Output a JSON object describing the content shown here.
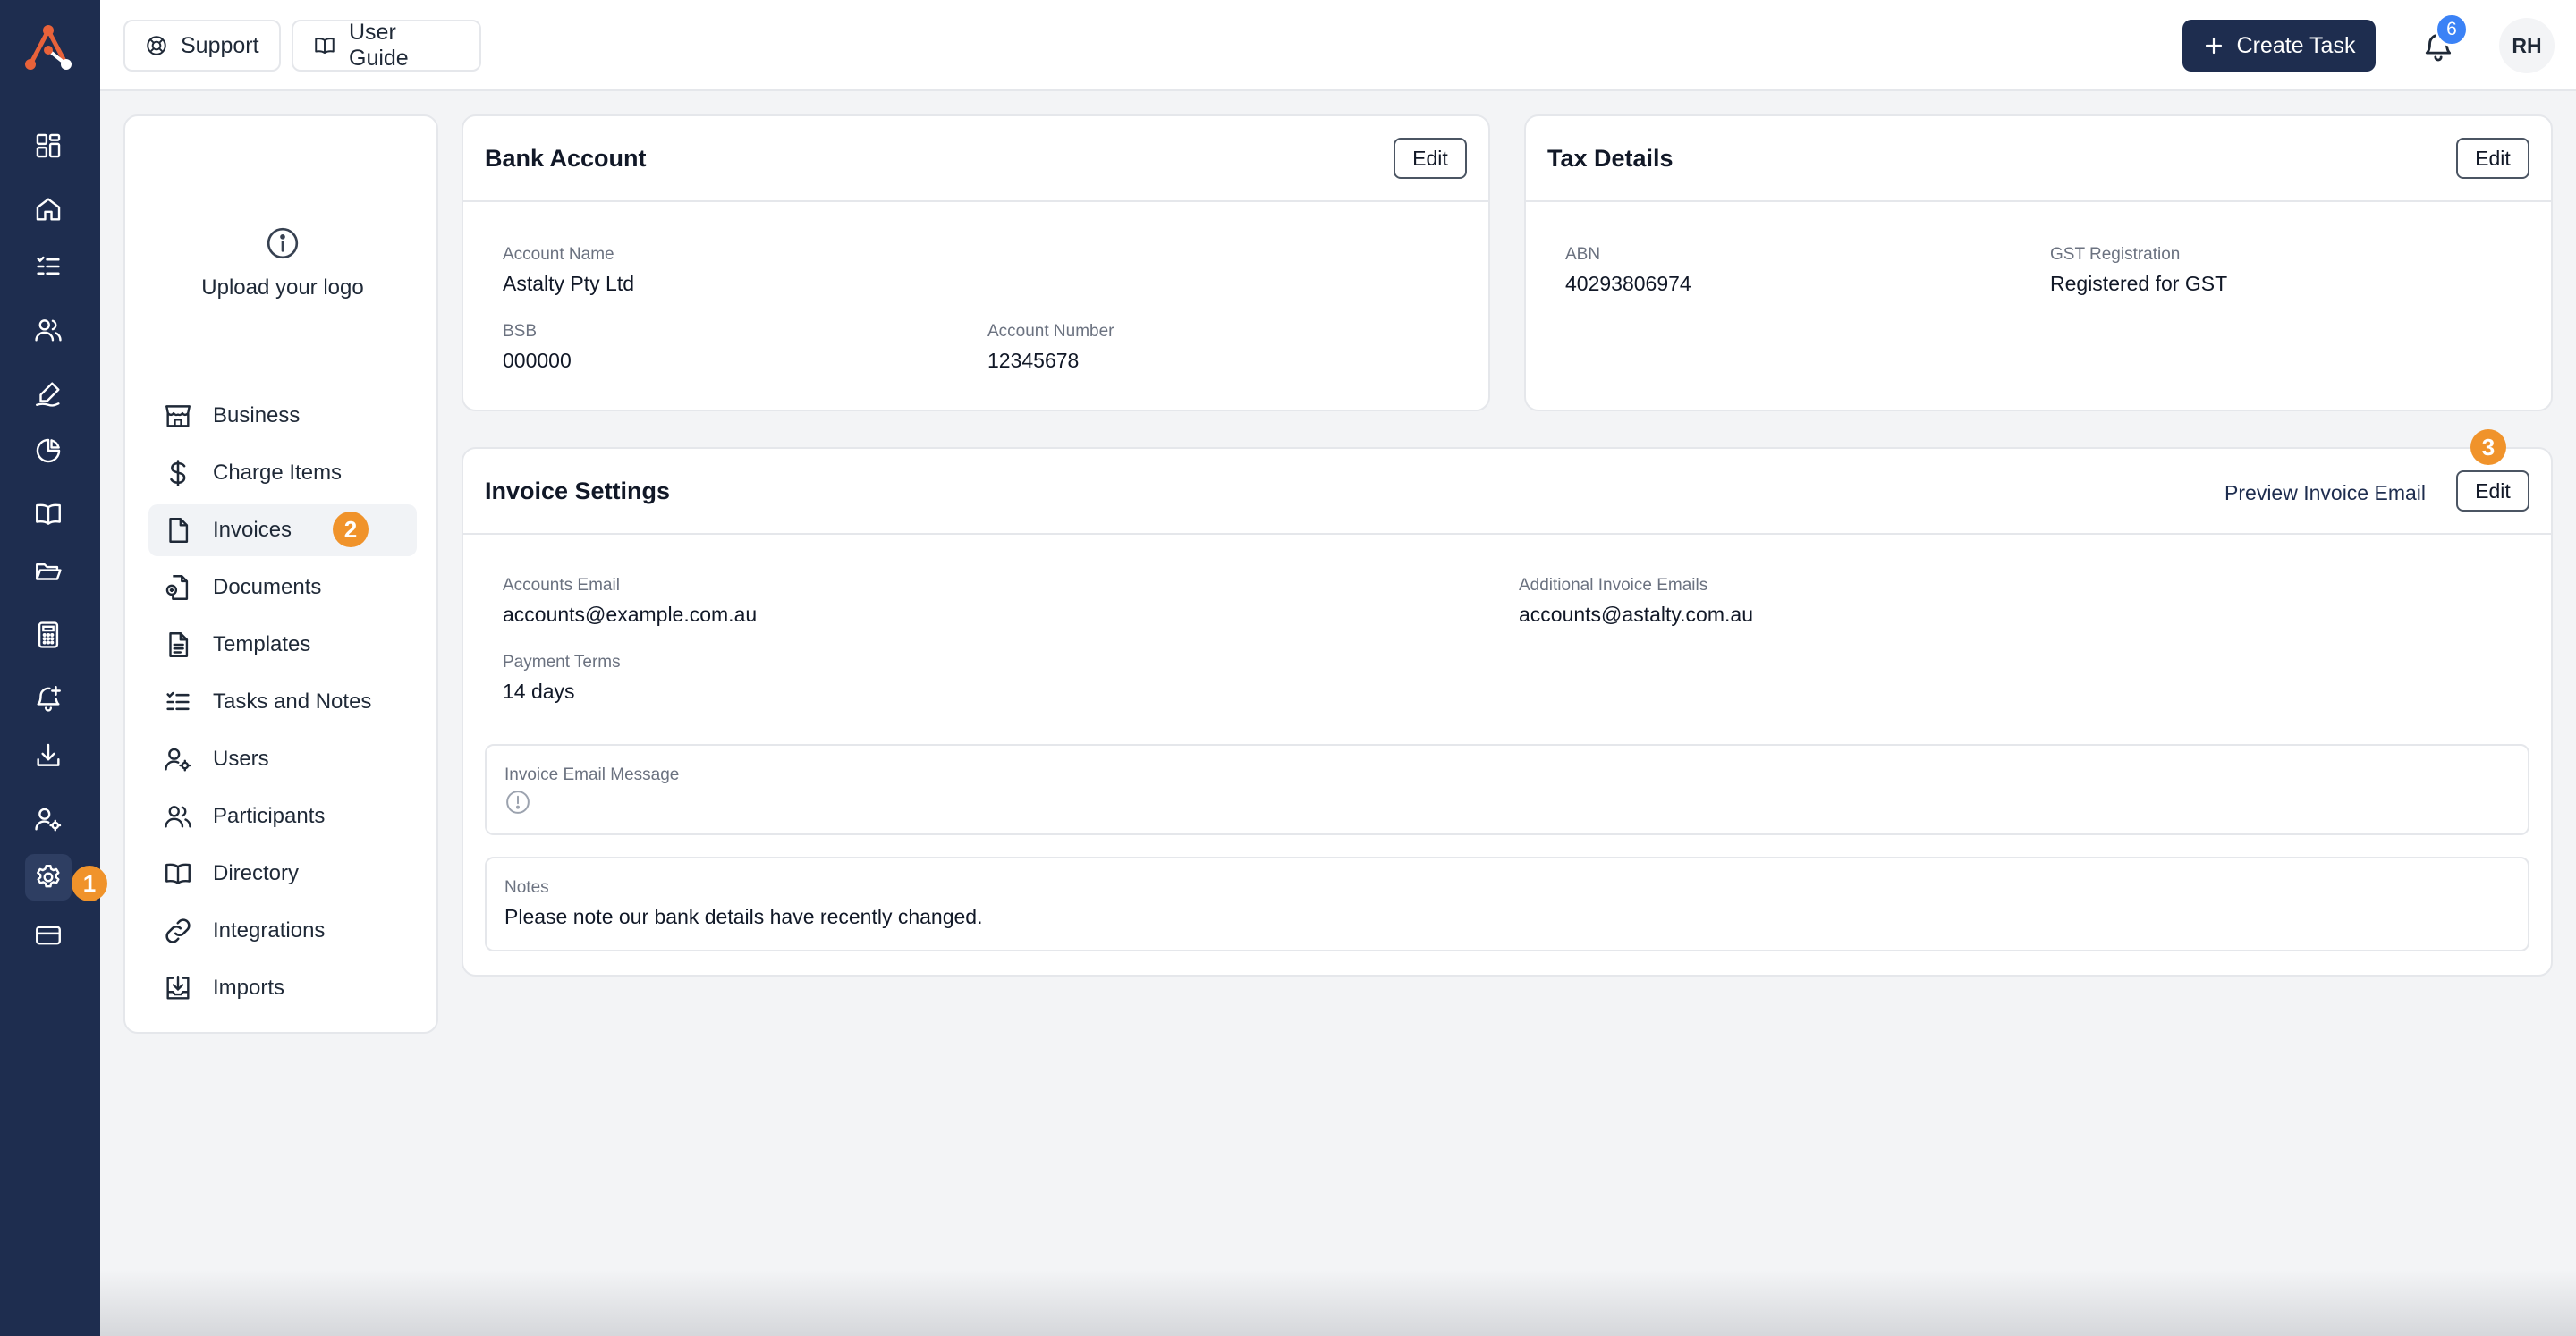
{
  "topbar": {
    "support_label": "Support",
    "user_guide_label": "User Guide",
    "create_task_label": "Create Task",
    "notification_count": "6",
    "avatar_initials": "RH"
  },
  "rail": {
    "step_badge": "1",
    "icons": [
      "dashboard-icon",
      "home-icon",
      "task-list-icon",
      "people-icon",
      "signature-icon",
      "pie-chart-icon",
      "book-icon",
      "folder-icon",
      "calculator-icon",
      "bell-plus-icon",
      "download-icon",
      "user-cog-icon",
      "gear-icon",
      "card-icon"
    ]
  },
  "settings_nav": {
    "upload_logo_label": "Upload your logo",
    "step_badge": "2",
    "items": [
      {
        "label": "Business",
        "icon": "store-icon"
      },
      {
        "label": "Charge Items",
        "icon": "dollar-icon"
      },
      {
        "label": "Invoices",
        "icon": "file-icon"
      },
      {
        "label": "Documents",
        "icon": "document-icon"
      },
      {
        "label": "Templates",
        "icon": "template-icon"
      },
      {
        "label": "Tasks and Notes",
        "icon": "task-list-icon"
      },
      {
        "label": "Users",
        "icon": "user-cog-icon"
      },
      {
        "label": "Participants",
        "icon": "people-icon"
      },
      {
        "label": "Directory",
        "icon": "book-icon"
      },
      {
        "label": "Integrations",
        "icon": "link-icon"
      },
      {
        "label": "Imports",
        "icon": "import-icon"
      }
    ]
  },
  "bank_account": {
    "title": "Bank Account",
    "edit_label": "Edit",
    "account_name_label": "Account Name",
    "account_name": "Astalty Pty Ltd",
    "bsb_label": "BSB",
    "bsb": "000000",
    "account_number_label": "Account Number",
    "account_number": "12345678"
  },
  "tax_details": {
    "title": "Tax Details",
    "edit_label": "Edit",
    "abn_label": "ABN",
    "abn": "40293806974",
    "gst_label": "GST Registration",
    "gst": "Registered for GST"
  },
  "invoice_settings": {
    "title": "Invoice Settings",
    "preview_label": "Preview Invoice Email",
    "edit_label": "Edit",
    "step_badge": "3",
    "accounts_email_label": "Accounts Email",
    "accounts_email": "accounts@example.com.au",
    "additional_emails_label": "Additional Invoice Emails",
    "additional_emails": "accounts@astalty.com.au",
    "payment_terms_label": "Payment Terms",
    "payment_terms": "14 days",
    "email_message_label": "Invoice Email Message",
    "notes_label": "Notes",
    "notes": "Please note our bank details have recently changed."
  },
  "colors": {
    "rail": "#1e2d4f",
    "primary": "#1e2d4f",
    "badge": "#f0932b",
    "notification": "#3b82f6"
  }
}
